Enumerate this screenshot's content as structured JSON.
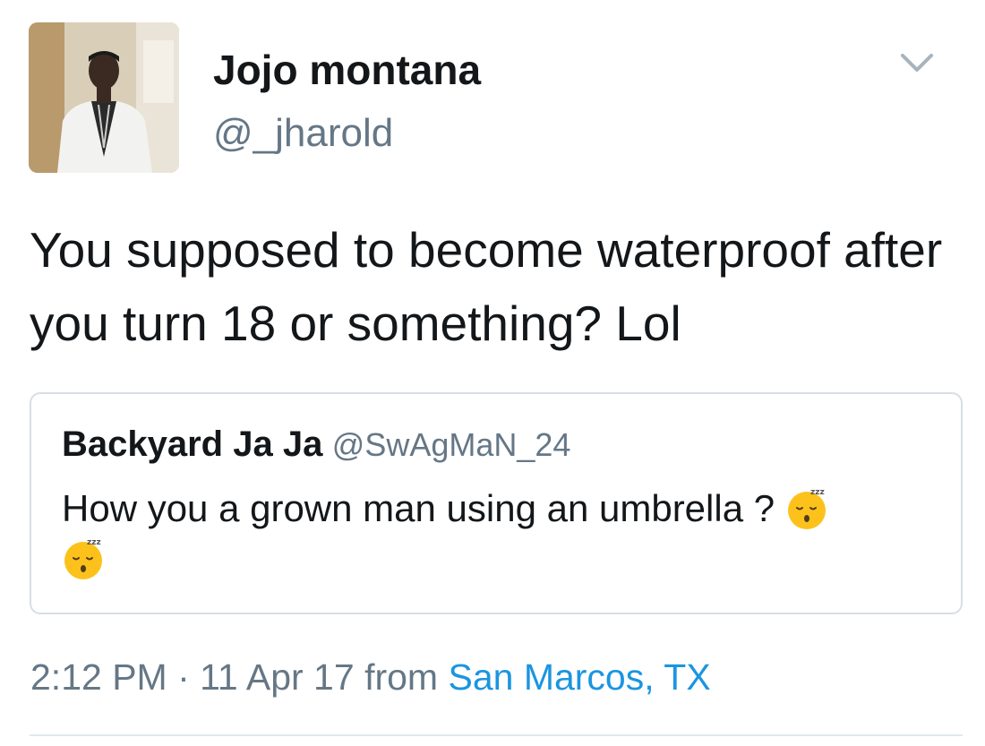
{
  "tweet": {
    "author": {
      "display_name": "Jojo montana",
      "handle": "@_jharold"
    },
    "text": "You supposed to become waterproof after you turn 18 or something? Lol",
    "menu_icon": "chevron-down-icon",
    "quoted": {
      "author_name": "Backyard Ja Ja",
      "author_handle": "@SwAgMaN_24",
      "text": "How you a grown man using an umbrella ?",
      "emoji": "sleeping-face-emoji"
    },
    "meta": {
      "time": "2:12 PM",
      "separator": "·",
      "date": "11 Apr 17",
      "from_label": "from",
      "location": "San Marcos, TX"
    }
  },
  "colors": {
    "text": "#14171a",
    "secondary": "#657786",
    "link": "#1b95e0",
    "border": "#d8dee3"
  }
}
